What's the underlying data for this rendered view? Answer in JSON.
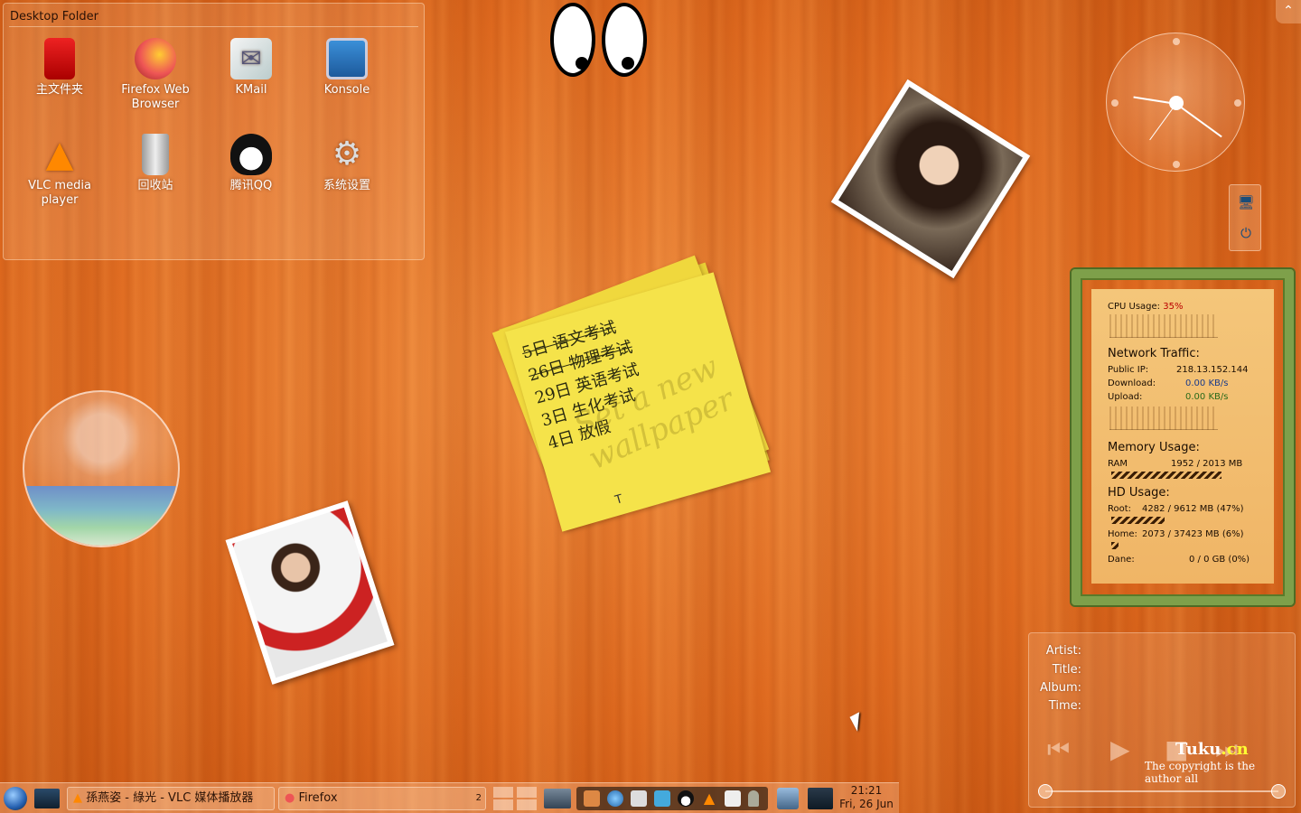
{
  "folder": {
    "title": "Desktop Folder",
    "icons": [
      {
        "label": "主文件夹",
        "icon": "red-cabinet-icon"
      },
      {
        "label": "Firefox Web Browser",
        "icon": "firefox-icon"
      },
      {
        "label": "KMail",
        "icon": "mail-icon"
      },
      {
        "label": "Konsole",
        "icon": "monitor-icon"
      },
      {
        "label": "VLC media player",
        "icon": "vlc-cone-icon"
      },
      {
        "label": "回收站",
        "icon": "trash-icon"
      },
      {
        "label": "腾讯QQ",
        "icon": "penguin-icon"
      },
      {
        "label": "系统设置",
        "icon": "settings-tools-icon"
      }
    ]
  },
  "note": {
    "lines": [
      "5日 语文考试",
      "26日 物理考试",
      "29日 英语考试",
      "3日 生化考试",
      "4日 放假"
    ],
    "watermark": "Set a new wallpaper",
    "color": "#f5e34a"
  },
  "sysmon": {
    "cpu_label": "CPU Usage:",
    "cpu_value": "35%",
    "network_head": "Network Traffic:",
    "public_ip_label": "Public IP:",
    "public_ip": "218.13.152.144",
    "download_label": "Download:",
    "download": "0.00 KB/s",
    "upload_label": "Upload:",
    "upload": "0.00 KB/s",
    "memory_head": "Memory Usage:",
    "ram_label": "RAM",
    "ram_value": "1952 / 2013 MB",
    "ram_fraction": 0.97,
    "hd_head": "HD Usage:",
    "root_label": "Root:",
    "root_value": "4282 / 9612 MB  (47%)",
    "root_fraction": 0.47,
    "home_label": "Home:",
    "home_value": "2073 / 37423 MB  (6%)",
    "home_fraction": 0.06,
    "dane_label": "Dane:",
    "dane_value": "0 / 0 GB  (0%)",
    "dane_fraction": 0.0
  },
  "player": {
    "artist_label": "Artist:",
    "title_label": "Title:",
    "album_label": "Album:",
    "time_label": "Time:",
    "watermark_logo": "Tuku",
    "watermark_suffix": ".cn",
    "watermark_text": "The copyright is the author all"
  },
  "taskbar": {
    "tasks": [
      {
        "label": "孫燕姿 - 綠光 - VLC 媒体播放器",
        "icon": "vlc-cone-icon"
      },
      {
        "label": "Firefox",
        "icon": "firefox-icon"
      }
    ],
    "task_count": "2",
    "clock_time": "21:21",
    "clock_date": "Fri, 26 Jun"
  }
}
